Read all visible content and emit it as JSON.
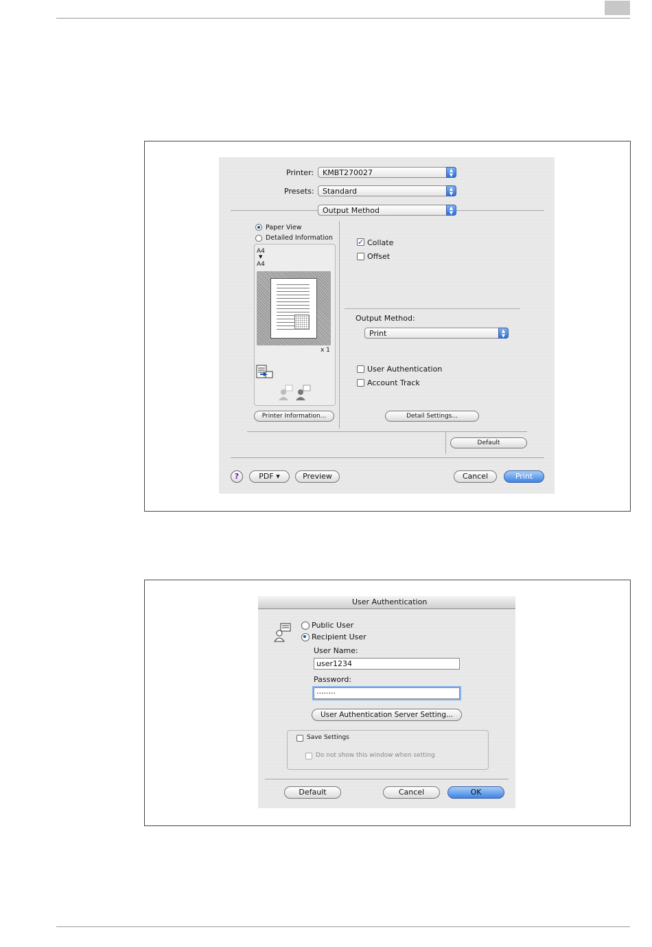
{
  "print_dialog": {
    "printer_label": "Printer:",
    "printer_value": "KMBT270027",
    "presets_label": "Presets:",
    "presets_value": "Standard",
    "panel_value": "Output Method",
    "paper_view": "Paper View",
    "detailed_information": "Detailed Information",
    "paper_from": "A4",
    "paper_arrow": "▼",
    "paper_to": "A4",
    "copies": "x 1",
    "printer_information_button": "Printer Information...",
    "collate": "Collate",
    "offset": "Offset",
    "output_method_label": "Output Method:",
    "output_method_value": "Print",
    "user_authentication": "User Authentication",
    "account_track": "Account Track",
    "detail_settings_button": "Detail Settings...",
    "default_button": "Default",
    "help_button": "?",
    "pdf_button": "PDF ▾",
    "preview_button": "Preview",
    "cancel_button": "Cancel",
    "print_button": "Print"
  },
  "auth_dialog": {
    "title": "User Authentication",
    "public_user": "Public User",
    "recipient_user": "Recipient User",
    "user_name_label": "User Name:",
    "user_name_value": "user1234",
    "password_label": "Password:",
    "password_value": "········",
    "server_setting_button": "User Authentication Server Setting...",
    "save_settings": "Save Settings",
    "do_not_show": "Do not show this window when setting",
    "default_button": "Default",
    "cancel_button": "Cancel",
    "ok_button": "OK"
  },
  "colors": {
    "accent_blue": "#3d84e3",
    "dialog_background": "#e9e9e9"
  }
}
